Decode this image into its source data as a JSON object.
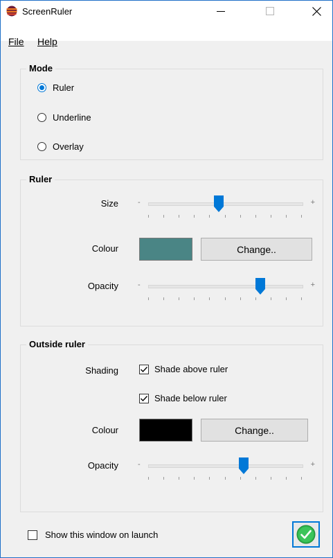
{
  "window": {
    "title": "ScreenRuler",
    "minimize_icon": "minimize-icon",
    "maximize_icon": "maximize-icon",
    "close_icon": "close-icon"
  },
  "menu": {
    "file": "File",
    "help": "Help"
  },
  "mode": {
    "legend": "Mode",
    "options": [
      {
        "label": "Ruler",
        "checked": true
      },
      {
        "label": "Underline",
        "checked": false
      },
      {
        "label": "Overlay",
        "checked": false
      }
    ]
  },
  "ruler": {
    "legend": "Ruler",
    "size_label": "Size",
    "size_value": 0.46,
    "colour_label": "Colour",
    "colour_value": "#4a8585",
    "change_label": "Change..",
    "opacity_label": "Opacity",
    "opacity_value": 0.73
  },
  "outside": {
    "legend": "Outside ruler",
    "shading_label": "Shading",
    "shade_above_label": "Shade above ruler",
    "shade_above_checked": true,
    "shade_below_label": "Shade below ruler",
    "shade_below_checked": true,
    "colour_label": "Colour",
    "colour_value": "#000000",
    "change_label": "Change..",
    "opacity_label": "Opacity",
    "opacity_value": 0.62
  },
  "footer": {
    "show_on_launch_label": "Show this window on launch",
    "show_on_launch_checked": false,
    "ok_icon": "ok-check-icon"
  },
  "colors": {
    "accent": "#0078d7",
    "ok_green": "#2db34a"
  }
}
